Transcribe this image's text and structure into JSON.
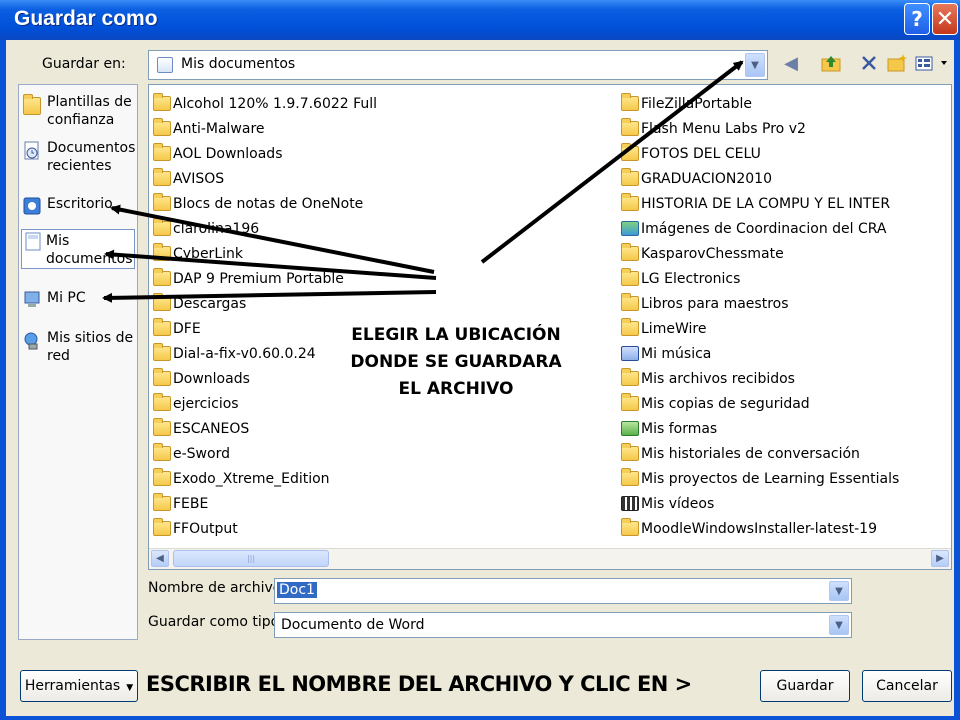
{
  "window": {
    "title": "Guardar como",
    "help_glyph": "?",
    "close_glyph": "✕"
  },
  "save_in": {
    "label": "Guardar en:",
    "value": "Mis documentos"
  },
  "toolbar": {
    "icons": [
      "back-icon",
      "up-folder-icon",
      "delete-icon",
      "new-folder-icon",
      "views-icon"
    ]
  },
  "places": [
    {
      "label": "Plantillas de confianza",
      "icon": "folder-icon"
    },
    {
      "label": "Documentos recientes",
      "icon": "recent-documents-icon"
    },
    {
      "label": "Escritorio",
      "icon": "desktop-icon"
    },
    {
      "label": "Mis documentos",
      "icon": "my-documents-icon"
    },
    {
      "label": "Mi PC",
      "icon": "my-computer-icon"
    },
    {
      "label": "Mis sitios de red",
      "icon": "network-places-icon"
    }
  ],
  "files_left": [
    "Alcohol 120% 1.9.7.6022 Full",
    "Anti-Malware",
    "AOL Downloads",
    "AVISOS",
    "Blocs de notas de OneNote",
    "clarolina196",
    "CyberLink",
    "DAP 9 Premium Portable",
    "Descargas",
    "DFE",
    "Dial-a-fix-v0.60.0.24",
    "Downloads",
    "ejercicios",
    "ESCANEOS",
    "e-Sword",
    "Exodo_Xtreme_Edition",
    "FEBE",
    "FFOutput"
  ],
  "files_right": [
    {
      "name": "FileZillaPortable",
      "icon": "folder-icon"
    },
    {
      "name": "Flash Menu Labs Pro v2",
      "icon": "folder-icon"
    },
    {
      "name": "FOTOS DEL CELU",
      "icon": "folder-icon"
    },
    {
      "name": "GRADUACION2010",
      "icon": "folder-icon"
    },
    {
      "name": "HISTORIA DE LA COMPU Y EL INTER",
      "icon": "folder-icon"
    },
    {
      "name": "Imágenes de Coordinacion del CRA",
      "icon": "pictures-folder-icon"
    },
    {
      "name": "KasparovChessmate",
      "icon": "folder-icon"
    },
    {
      "name": "LG Electronics",
      "icon": "folder-icon"
    },
    {
      "name": "Libros para maestros",
      "icon": "folder-icon"
    },
    {
      "name": "LimeWire",
      "icon": "folder-icon"
    },
    {
      "name": "Mi música",
      "icon": "music-folder-icon"
    },
    {
      "name": "Mis archivos recibidos",
      "icon": "folder-icon"
    },
    {
      "name": "Mis copias de seguridad",
      "icon": "folder-icon"
    },
    {
      "name": "Mis formas",
      "icon": "forms-folder-icon"
    },
    {
      "name": "Mis historiales de conversación",
      "icon": "folder-icon"
    },
    {
      "name": "Mis proyectos de Learning Essentials",
      "icon": "folder-icon"
    },
    {
      "name": "Mis vídeos",
      "icon": "video-folder-icon"
    },
    {
      "name": "MoodleWindowsInstaller-latest-19",
      "icon": "folder-icon"
    }
  ],
  "filename": {
    "label": "Nombre de archivo:",
    "value": "Doc1"
  },
  "filetype": {
    "label": "Guardar como tipo:",
    "value": "Documento de Word"
  },
  "buttons": {
    "tools": "Herramientas",
    "save": "Guardar",
    "cancel": "Cancelar"
  },
  "annotations": {
    "location_lines": [
      "ELEGIR LA UBICACIÓN",
      "DONDE SE GUARDARA",
      "EL ARCHIVO"
    ],
    "bottom": "ESCRIBIR EL NOMBRE DEL ARCHIVO Y CLIC EN >"
  },
  "colors": {
    "title_bar": "#0a5ee0",
    "dialog_bg": "#ece9d8",
    "folder_yellow": "#f5c84a"
  }
}
